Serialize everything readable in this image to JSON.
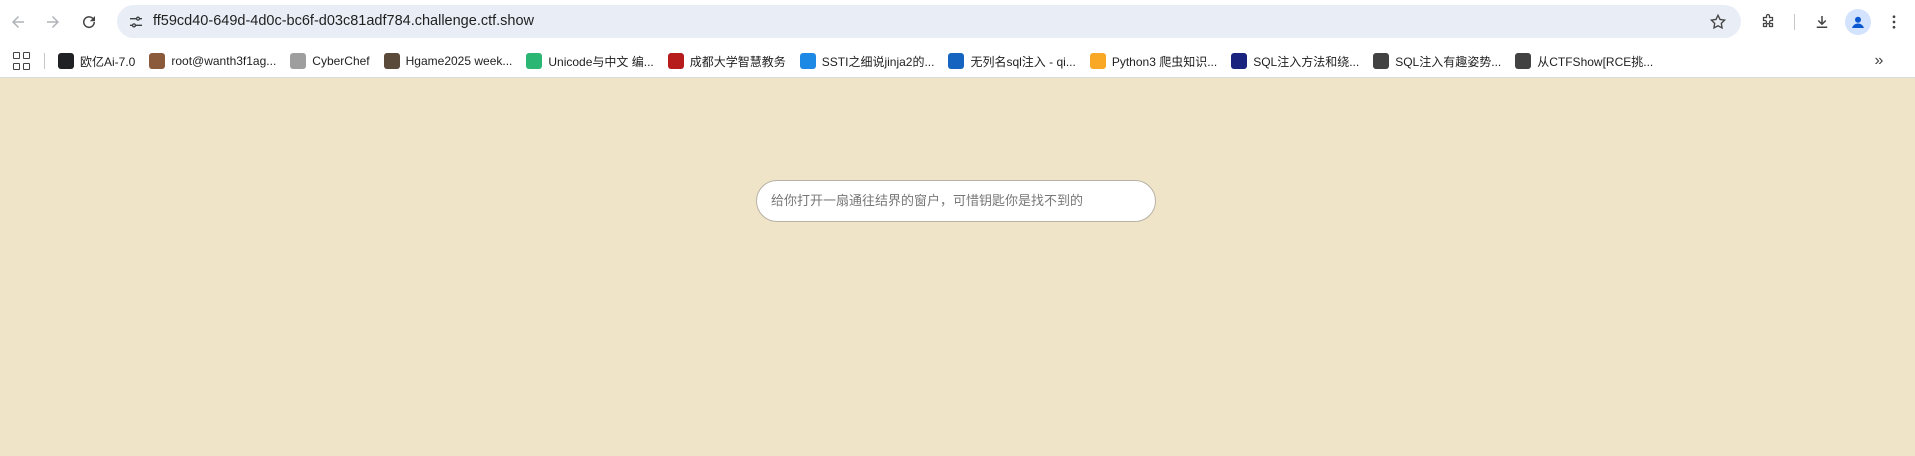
{
  "browser": {
    "url": "ff59cd40-649d-4d0c-bc6f-d03c81adf784.challenge.ctf.show",
    "bookmarks": [
      {
        "label": "欧亿Ai-7.0",
        "icon": "chat-bubble-icon",
        "color": "#202124"
      },
      {
        "label": "root@wanth3f1ag...",
        "icon": "avatar-photo-icon",
        "color": "#8a5a3a"
      },
      {
        "label": "CyberChef",
        "icon": "chef-hat-icon",
        "color": "#9e9e9e"
      },
      {
        "label": "Hgame2025 week...",
        "icon": "person-avatar-icon",
        "color": "#5a4a3a"
      },
      {
        "label": "Unicode与中文 编...",
        "icon": "t-logo-icon",
        "color": "#2bb673"
      },
      {
        "label": "成都大学智慧教务",
        "icon": "university-seal-icon",
        "color": "#b71c1c"
      },
      {
        "label": "SSTI之细说jinja2的...",
        "icon": "shield-logo-icon",
        "color": "#1e88e5"
      },
      {
        "label": "无列名sql注入 - qi...",
        "icon": "circle-c-icon",
        "color": "#1565c0"
      },
      {
        "label": "Python3 爬虫知识...",
        "icon": "biohazard-icon",
        "color": "#f9a825"
      },
      {
        "label": "SQL注入方法和绕...",
        "icon": "dark-thumbnail-icon",
        "color": "#1a237e"
      },
      {
        "label": "SQL注入有趣姿势...",
        "icon": "slash-logo-icon",
        "color": "#424242"
      },
      {
        "label": "从CTFShow[RCE挑...",
        "icon": "slash-logo-icon",
        "color": "#424242"
      }
    ]
  },
  "page": {
    "input_placeholder": "给你打开一扇通往结界的窗户，可惜钥匙你是找不到的",
    "input_value": ""
  }
}
